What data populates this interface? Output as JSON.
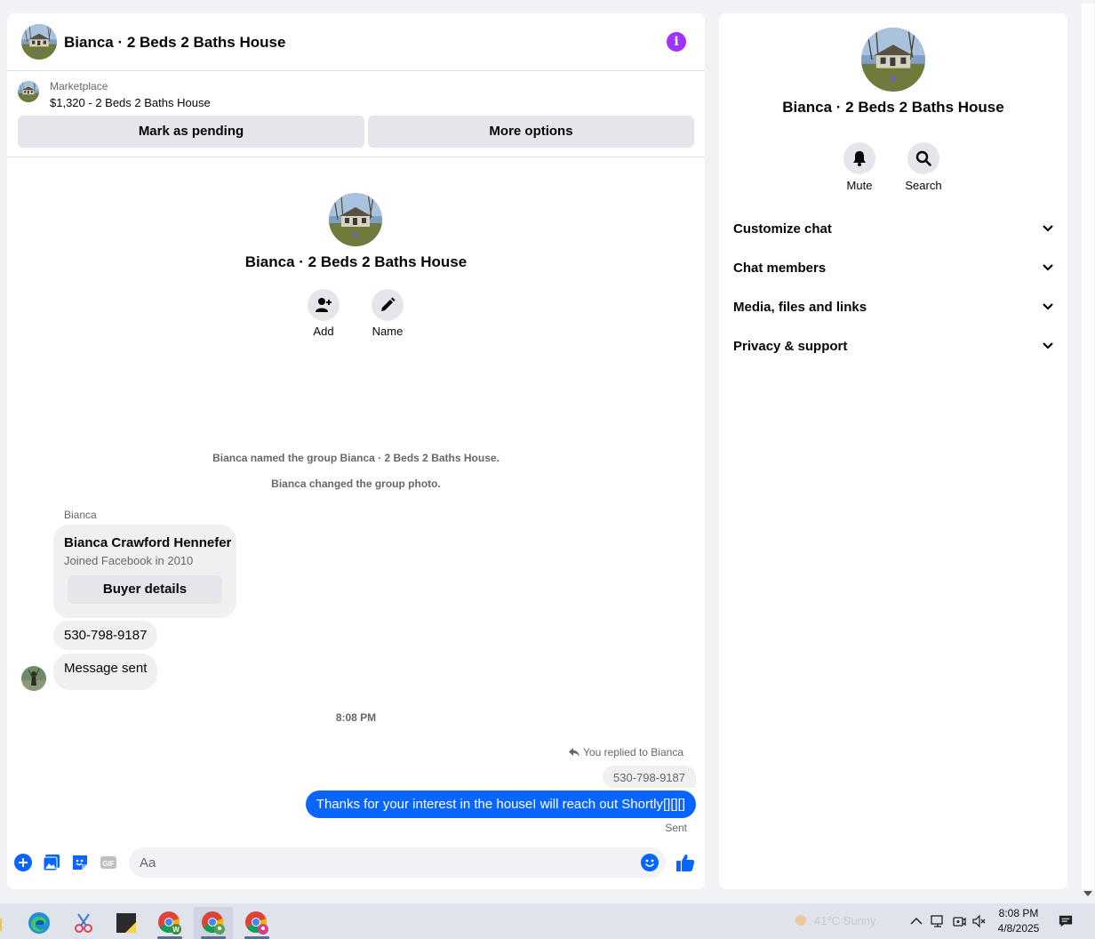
{
  "chat": {
    "title": "Bianca · 2 Beds 2 Baths House",
    "listing": {
      "label": "Marketplace",
      "price_title": "$1,320 - 2 Beds 2 Baths House"
    },
    "buttons": {
      "mark_pending": "Mark as pending",
      "more_options": "More options"
    },
    "intro": {
      "group_name": "Bianca · 2 Beds 2 Baths House",
      "add_label": "Add",
      "name_label": "Name"
    },
    "system_messages": [
      "Bianca named the group Bianca · 2 Beds 2 Baths House.",
      "Bianca changed the group photo."
    ],
    "incoming": {
      "sender": "Bianca",
      "profile_name": "Bianca Crawford Hennefer",
      "profile_sub": "Joined Facebook in 2010",
      "buyer_details": "Buyer details",
      "phone": "530-798-9187",
      "message_sent": "Message sent"
    },
    "timestamp": "8:08 PM",
    "outgoing": {
      "replied_to": "You replied to Bianca",
      "quoted": "530-798-9187",
      "text": "Thanks for your interest in the houseI will reach out Shortly[][][]",
      "status": "Sent"
    },
    "composer": {
      "placeholder": "Aa"
    }
  },
  "details": {
    "title": "Bianca · 2 Beds 2 Baths House",
    "mute_label": "Mute",
    "search_label": "Search",
    "sections": [
      "Customize chat",
      "Chat members",
      "Media, files and links",
      "Privacy & support"
    ]
  },
  "taskbar": {
    "weather": "41°C  Sunny",
    "time": "8:08 PM",
    "date": "4/8/2025"
  },
  "colors": {
    "accent_blue": "#0866ff",
    "info_purple": "#a033ff",
    "bubble_grey": "#f0f0f0",
    "button_grey": "#e4e6eb"
  }
}
